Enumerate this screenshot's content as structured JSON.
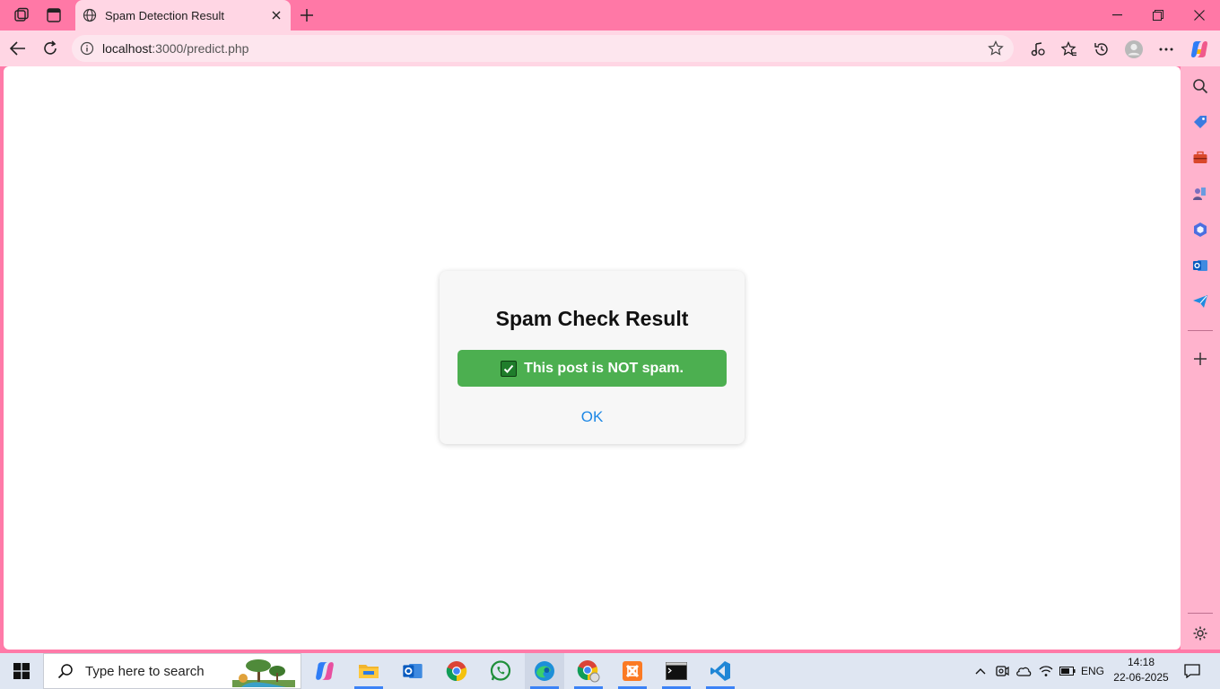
{
  "browser": {
    "tab_title": "Spam Detection Result",
    "url_host": "localhost",
    "url_path": ":3000/predict.php"
  },
  "dialog": {
    "title": "Spam Check Result",
    "result_text": "This post is NOT spam.",
    "ok_label": "OK",
    "result_color": "#4caf50",
    "link_color": "#1e88e5"
  },
  "taskbar": {
    "search_placeholder": "Type here to search",
    "language": "ENG",
    "time": "14:18",
    "date": "22-06-2025"
  },
  "theme": {
    "frame_color": "#ff78a6",
    "toolbar_color": "#ffd6e4",
    "sidebar_color": "#ffb3cd"
  }
}
